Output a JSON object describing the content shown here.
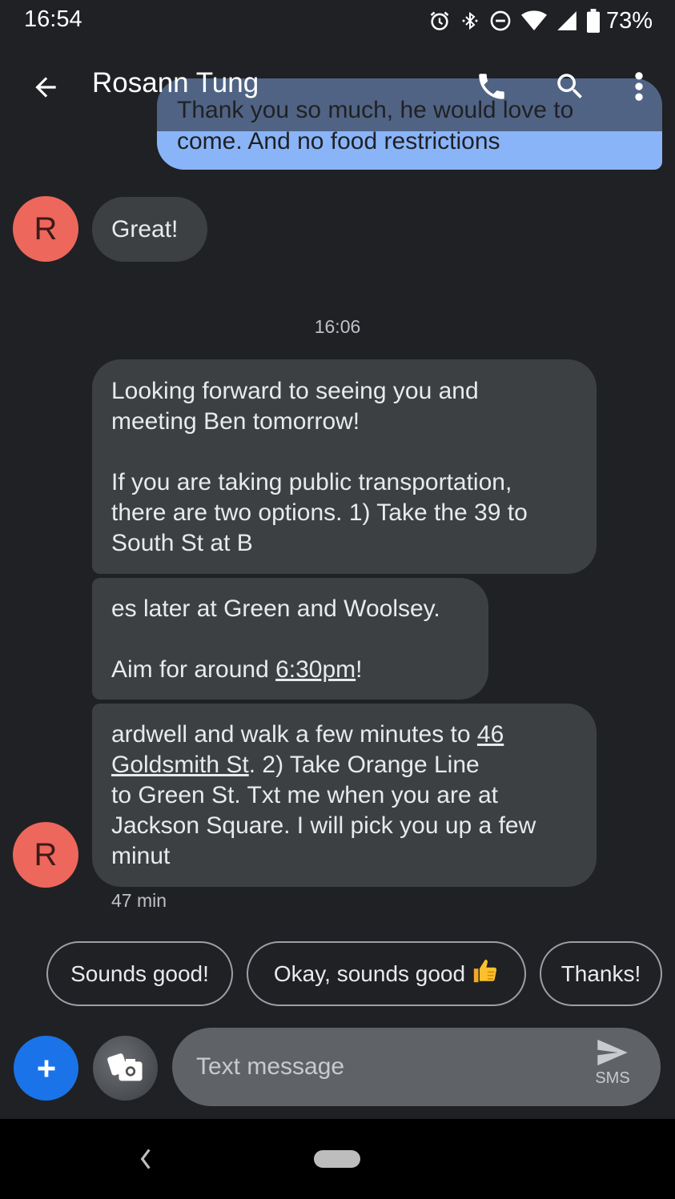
{
  "status_bar": {
    "time": "16:54",
    "battery_percent": "73%",
    "icons": [
      "alarm-icon",
      "bluetooth-icon",
      "do-not-disturb-icon",
      "wifi-icon",
      "signal-icon",
      "battery-icon"
    ]
  },
  "app_bar": {
    "contact_name": "Rosann Tung",
    "icons": [
      "back-arrow-icon",
      "phone-icon",
      "search-icon",
      "more-vert-icon"
    ]
  },
  "conversation": {
    "sent_partial": {
      "line1": "Thank you so much, he would love to",
      "line2": "come. And no food restrictions"
    },
    "avatar_letter": "R",
    "great_message": "Great!",
    "timestamp": "16:06",
    "message_1": {
      "l1": "Looking forward to seeing you and",
      "l2": "meeting Ben tomorrow!",
      "l3": "If you are taking public transportation,",
      "l4": "there are two options. 1) Take the 39 to",
      "l5": "South St at B"
    },
    "message_2": {
      "l1": "es later at Green and Woolsey.",
      "l2_pre": "Aim for around ",
      "l2_link": "6:30pm",
      "l2_post": "!"
    },
    "message_3": {
      "l1_pre": "ardwell and walk a few minutes to ",
      "l1_link": "46",
      "l2_link": "Goldsmith St",
      "l2_post": ". 2) Take Orange Line",
      "l3": "to Green St. Txt me when you are at",
      "l4": "Jackson Square. I will pick you up a few",
      "l5": "minut"
    },
    "message_age": "47 min"
  },
  "suggestions": [
    "Sounds good!",
    "Okay, sounds good",
    "Thanks!"
  ],
  "compose": {
    "placeholder": "Text message",
    "send_label": "SMS"
  },
  "colors": {
    "background": "#202124",
    "sent_bubble": "#8ab4f8",
    "received_bubble": "#3c4043",
    "avatar": "#ee675c",
    "add_button": "#1a73e8"
  }
}
